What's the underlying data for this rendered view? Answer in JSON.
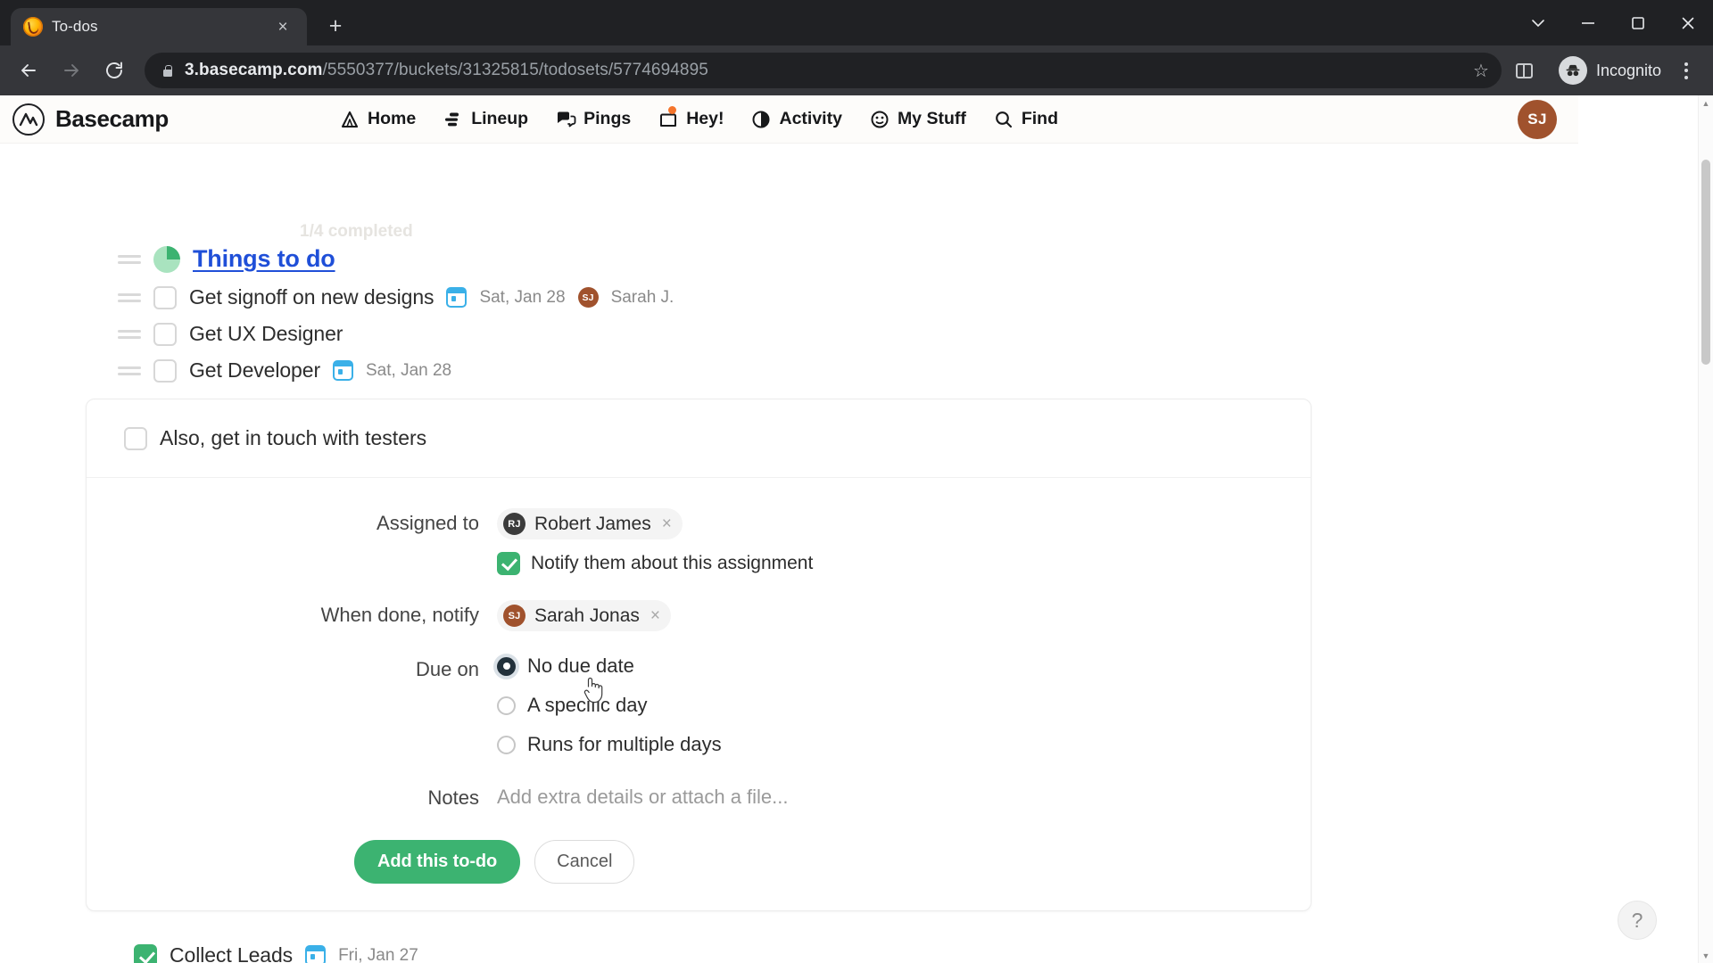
{
  "browser": {
    "tab": {
      "title": "To-dos",
      "favicon": "basecamp-favicon",
      "close_label": "×"
    },
    "new_tab_label": "+",
    "window_controls": {
      "minimize": "—",
      "maximize": "□",
      "close": "✕",
      "more": "⌄"
    },
    "nav": {
      "back": "←",
      "forward": "→",
      "reload": "↻"
    },
    "omnibox": {
      "url_domain": "3.basecamp.com",
      "url_path": "/5550377/buckets/31325815/todosets/5774694895",
      "lock_icon": "lock-icon",
      "star_icon": "☆",
      "side_panel_icon": "side-panel-icon"
    },
    "profile": {
      "label": "Incognito",
      "icon": "incognito-icon"
    },
    "menu_icon": "kebab-menu-icon"
  },
  "basecamp_nav": {
    "brand": "Basecamp",
    "items": [
      {
        "label": "Home",
        "icon": "home-icon",
        "badge": false
      },
      {
        "label": "Lineup",
        "icon": "lineup-icon",
        "badge": false
      },
      {
        "label": "Pings",
        "icon": "pings-icon",
        "badge": false
      },
      {
        "label": "Hey!",
        "icon": "hey-icon",
        "badge": true
      },
      {
        "label": "Activity",
        "icon": "activity-icon",
        "badge": false
      },
      {
        "label": "My Stuff",
        "icon": "my-stuff-icon",
        "badge": false
      },
      {
        "label": "Find",
        "icon": "search-icon",
        "badge": false
      }
    ],
    "avatar_initials": "SJ",
    "avatar_color": "#a0522d"
  },
  "main": {
    "completed_ghost": "1/4 completed",
    "list": {
      "title": "Things to do",
      "title_color": "#1f4fd8",
      "progress_color": "#3cb371",
      "items": [
        {
          "label": "Get signoff on new designs",
          "checked": false,
          "due_date": "Sat, Jan 28",
          "assignee": "Sarah J.",
          "assignee_initials": "SJ",
          "assignee_color": "#a0522d"
        },
        {
          "label": "Get UX Designer",
          "checked": false,
          "due_date": "",
          "assignee": "",
          "assignee_initials": "",
          "assignee_color": ""
        },
        {
          "label": "Get Developer",
          "checked": false,
          "due_date": "Sat, Jan 28",
          "assignee": "",
          "assignee_initials": "",
          "assignee_color": ""
        }
      ]
    },
    "composer": {
      "todo_title": "Also, get in touch with testers",
      "todo_checked": false,
      "assigned_to": {
        "label": "Assigned to",
        "chip_name": "Robert James",
        "chip_initials": "RJ",
        "chip_color": "#3c3c3c",
        "remove_label": "×"
      },
      "notify_assignment": {
        "label": "Notify them about this assignment",
        "checked": true,
        "color": "#3cb371"
      },
      "when_done_notify": {
        "label": "When done, notify",
        "chip_name": "Sarah Jonas",
        "chip_initials": "SJ",
        "chip_color": "#a0522d",
        "remove_label": "×"
      },
      "due_on": {
        "label": "Due on",
        "options": [
          {
            "label": "No due date",
            "selected": true
          },
          {
            "label": "A specific day",
            "selected": false
          },
          {
            "label": "Runs for multiple days",
            "selected": false
          }
        ]
      },
      "notes": {
        "label": "Notes",
        "placeholder": "Add extra details or attach a file...",
        "value": ""
      },
      "submit_label": "Add this to-do",
      "cancel_label": "Cancel",
      "submit_color": "#3cb371"
    },
    "completed_item": {
      "label": "Collect Leads",
      "checked": true,
      "due_date": "Fri, Jan 27"
    }
  },
  "help_widget": {
    "label": "?"
  }
}
